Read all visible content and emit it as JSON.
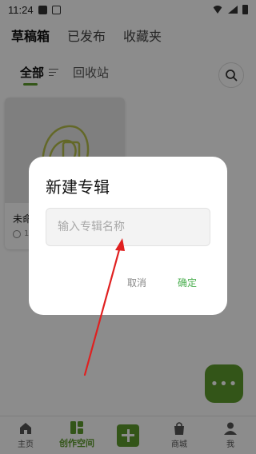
{
  "status_bar": {
    "time": "11:24"
  },
  "top_tabs": [
    "草稿箱",
    "已发布",
    "收藏夹"
  ],
  "sub_tabs": {
    "all": "全部",
    "recycle": "回收站"
  },
  "card": {
    "title": "未命",
    "meta": "1"
  },
  "fab": {
    "label": "•••"
  },
  "bottom_nav": {
    "home": "主页",
    "create": "创作空间",
    "mall": "商城",
    "me": "我"
  },
  "dialog": {
    "title": "新建专辑",
    "placeholder": "输入专辑名称",
    "input_value": "",
    "cancel": "取消",
    "confirm": "确定"
  },
  "colors": {
    "accent": "#5e9b2d",
    "confirm": "#4caf50",
    "annotation": "#e02020"
  }
}
